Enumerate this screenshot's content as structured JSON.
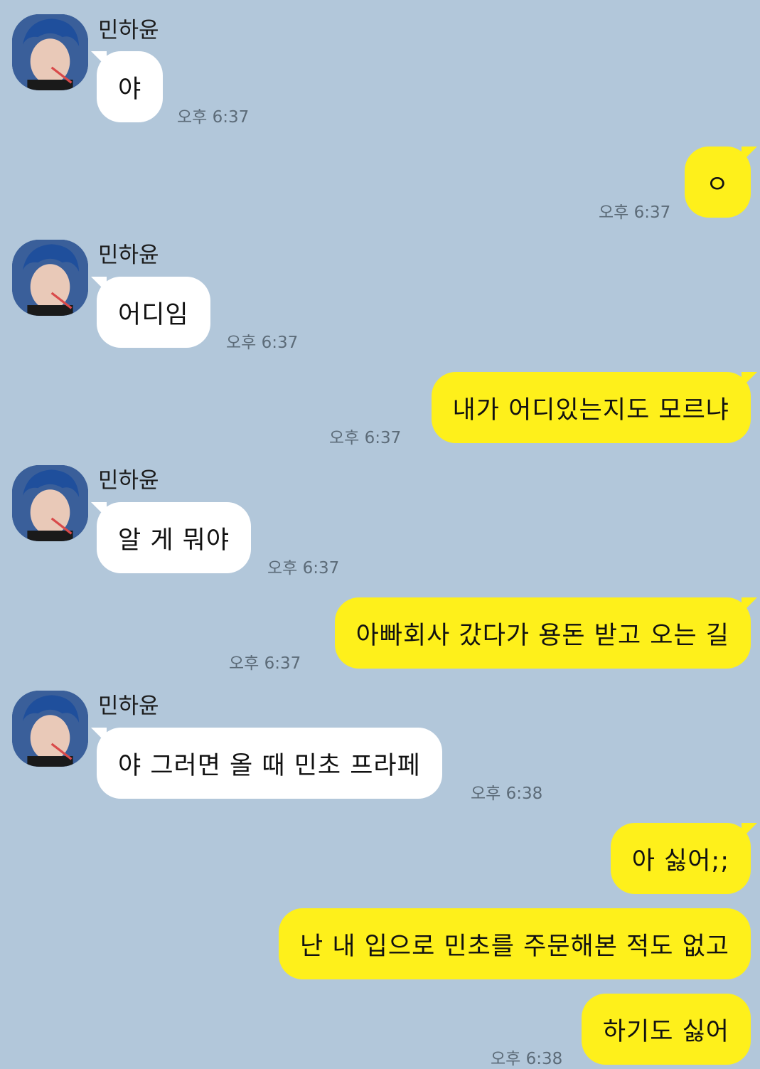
{
  "chat": {
    "contact_name": "민하윤",
    "messages": [
      {
        "side": "in",
        "text": "야",
        "time": "오후 6:37"
      },
      {
        "side": "out",
        "text": "ㅇ",
        "time": "오후 6:37"
      },
      {
        "side": "in",
        "text": "어디임",
        "time": "오후 6:37"
      },
      {
        "side": "out",
        "text": "내가 어디있는지도 모르냐",
        "time": "오후 6:37"
      },
      {
        "side": "in",
        "text": "알 게 뭐야",
        "time": "오후 6:37"
      },
      {
        "side": "out",
        "text": "아빠회사 갔다가 용돈 받고 오는 길",
        "time": "오후 6:37"
      },
      {
        "side": "in",
        "text": "야 그러면 올 때 민초 프라페",
        "time": "오후 6:38"
      },
      {
        "side": "out",
        "text": "아 싫어;;",
        "time": ""
      },
      {
        "side": "out",
        "text": "난 내 입으로 민초를 주문해본 적도 없고",
        "time": ""
      },
      {
        "side": "out",
        "text": "하기도 싫어",
        "time": "오후 6:38"
      }
    ]
  },
  "colors": {
    "background": "#b2c7da",
    "incoming_bubble": "#ffffff",
    "outgoing_bubble": "#fef01b"
  }
}
